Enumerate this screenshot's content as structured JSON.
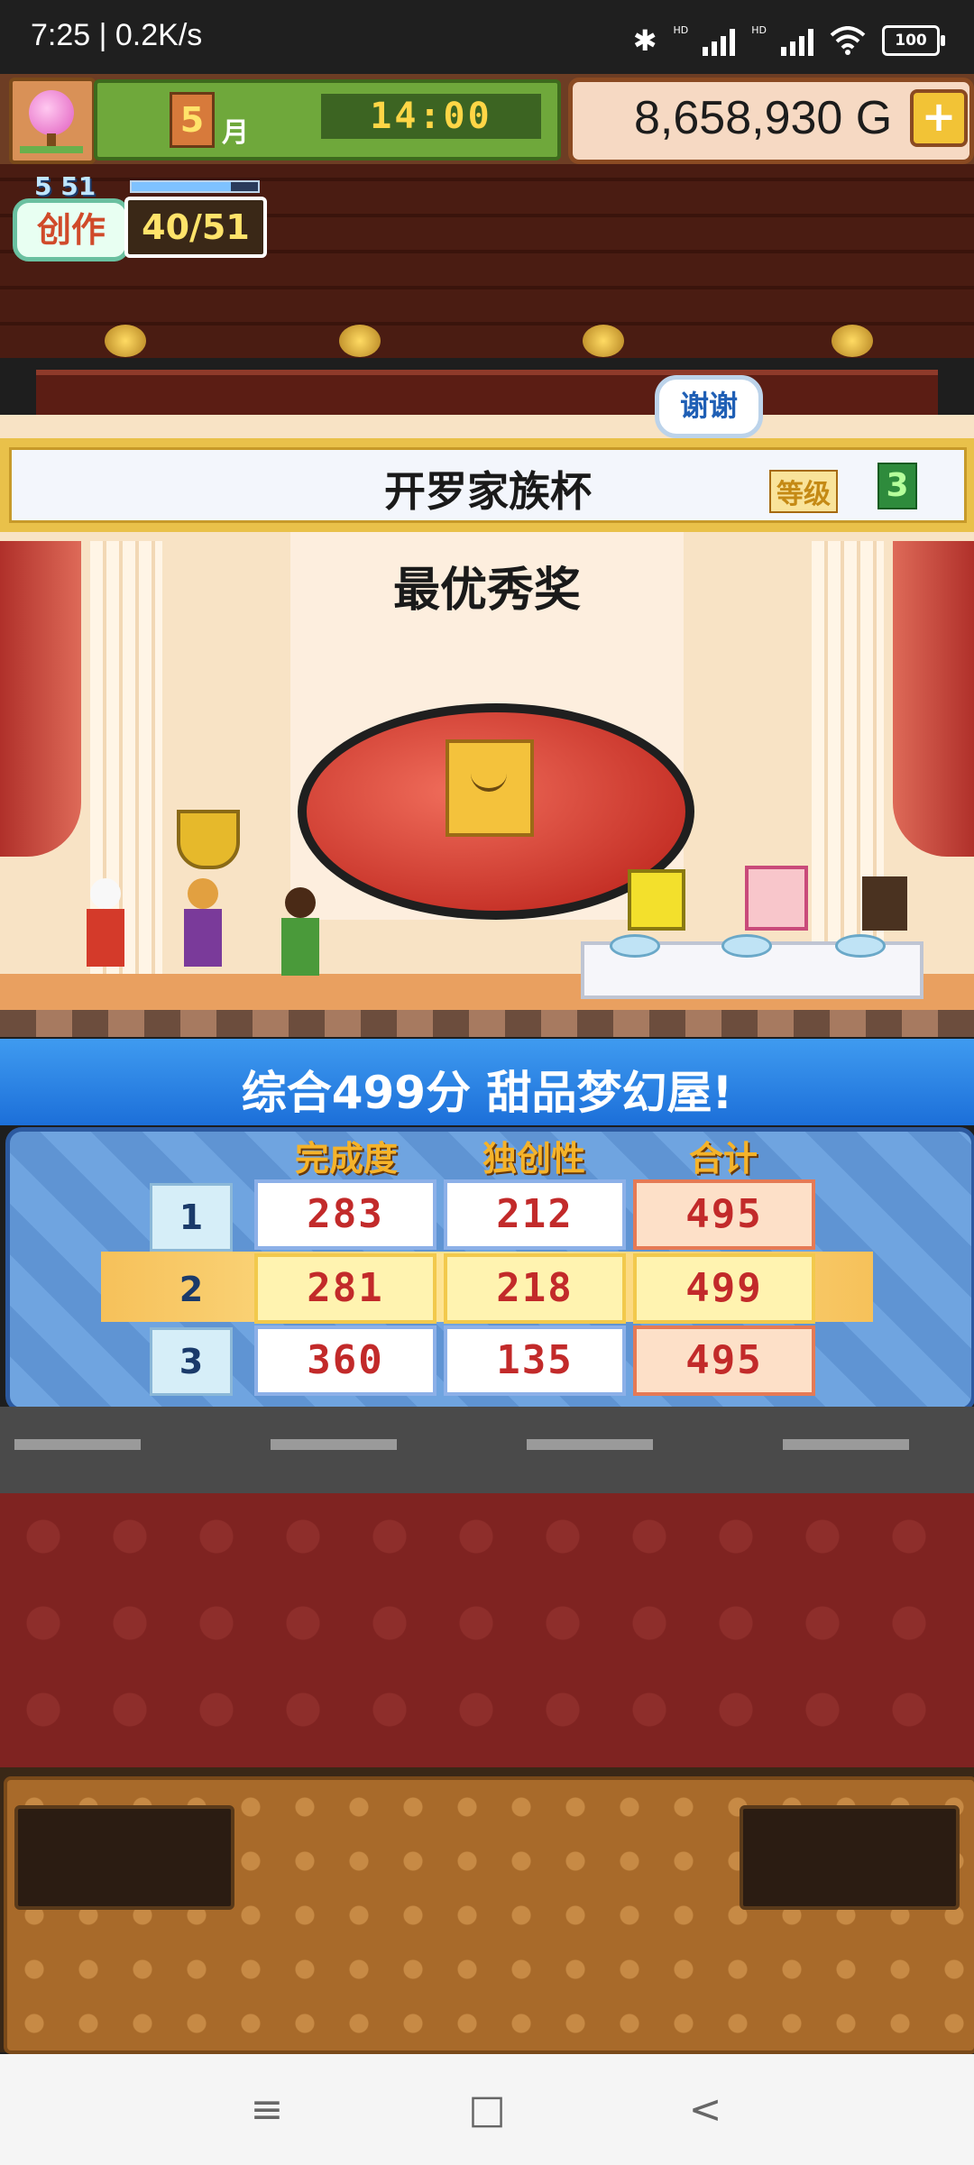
{
  "status_bar": {
    "left": "7:25 | 0.2K/s",
    "battery": "100",
    "network_labels": [
      "HD",
      "HD"
    ]
  },
  "hud": {
    "month": "5",
    "month_unit": "月",
    "time": "14:00",
    "money": "8,658,930 G",
    "add_money_symbol": "+",
    "creation_small": "5 51",
    "creation_label": "创作",
    "creation_progress": "40/51"
  },
  "stage": {
    "thanks_label": "谢谢",
    "event_title": "开罗家族杯",
    "grade_label": "等级",
    "grade_value": "3",
    "award_title": "最优秀奖"
  },
  "result": {
    "summary": "综合499分 甜品梦幻屋!",
    "columns": [
      "完成度",
      "独创性",
      "合计"
    ],
    "rows": [
      {
        "rank": "1",
        "values": [
          "283",
          "212",
          "495"
        ]
      },
      {
        "rank": "2",
        "values": [
          "281",
          "218",
          "499"
        ]
      },
      {
        "rank": "3",
        "values": [
          "360",
          "135",
          "495"
        ]
      }
    ]
  },
  "nav": {
    "menu_icon": "≡",
    "home_icon": "□",
    "back_icon": "<"
  },
  "colors": {
    "accent_blue": "#1c6fd9",
    "money_panel": "#f6d9c3",
    "date_panel": "#6fa83b",
    "score_red": "#c22a2a"
  }
}
